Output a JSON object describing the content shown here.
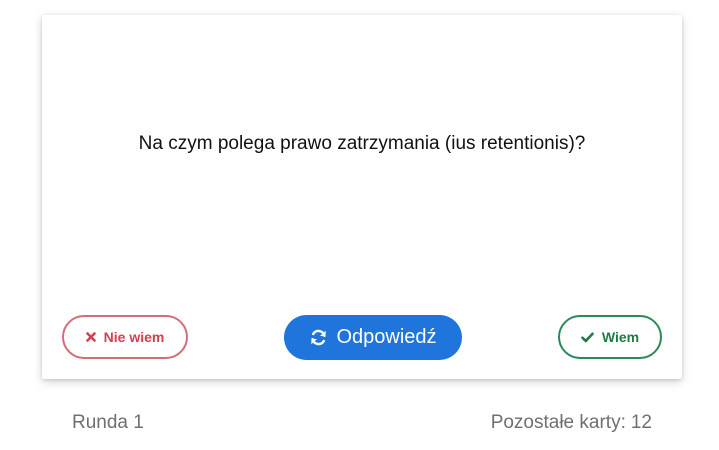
{
  "card": {
    "question": "Na czym polega prawo zatrzymania (ius retentionis)?"
  },
  "buttons": {
    "dont_know": {
      "label": "Nie wiem",
      "icon": "times-icon",
      "color": "#d2404c"
    },
    "answer": {
      "label": "Odpowiedź",
      "icon": "refresh-icon",
      "color": "#1f75db"
    },
    "know": {
      "label": "Wiem",
      "icon": "check-icon",
      "color": "#1f7a47"
    }
  },
  "footer": {
    "round_label": "Runda 1",
    "remaining_label": "Pozostałe karty:",
    "remaining_count": "12"
  }
}
